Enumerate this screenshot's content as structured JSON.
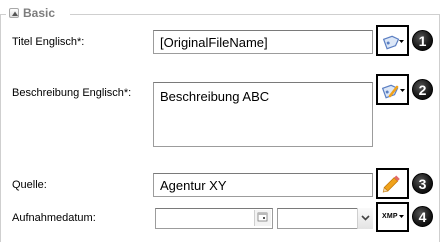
{
  "section": {
    "title": "Basic",
    "collapse_icon": "triangle-up-icon"
  },
  "fields": [
    {
      "label": "Titel Englisch*:",
      "value": "[OriginalFileName]",
      "tool_icon": "tag-dropdown-icon",
      "badge": "1"
    },
    {
      "label": "Beschreibung Englisch*:",
      "value": "Beschreibung ABC",
      "tool_icon": "tag-edit-dropdown-icon",
      "badge": "2"
    },
    {
      "label": "Quelle:",
      "value": "Agentur XY",
      "tool_icon": "pencil-icon",
      "badge": "3"
    },
    {
      "label": "Aufnahmedatum:",
      "date_value": "",
      "select_value": "",
      "tool_label": "XMP",
      "badge": "4"
    }
  ],
  "colors": {
    "section_title": "#7d7d7d",
    "badge_bg": "#111111",
    "tag_icon": "#5b7fc2",
    "pencil": "#f0a21b"
  }
}
